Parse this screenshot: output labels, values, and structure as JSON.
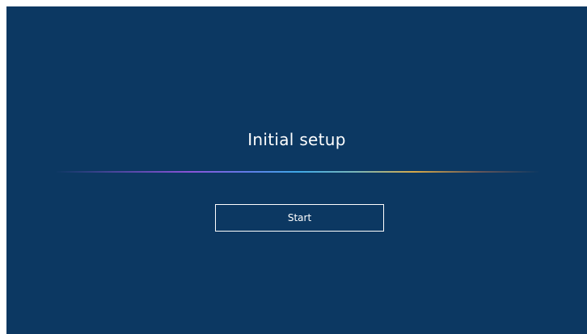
{
  "setup": {
    "title": "Initial setup",
    "start_label": "Start"
  },
  "colors": {
    "background": "#0c3862",
    "text": "#ffffff",
    "button_border": "#ffffff"
  }
}
